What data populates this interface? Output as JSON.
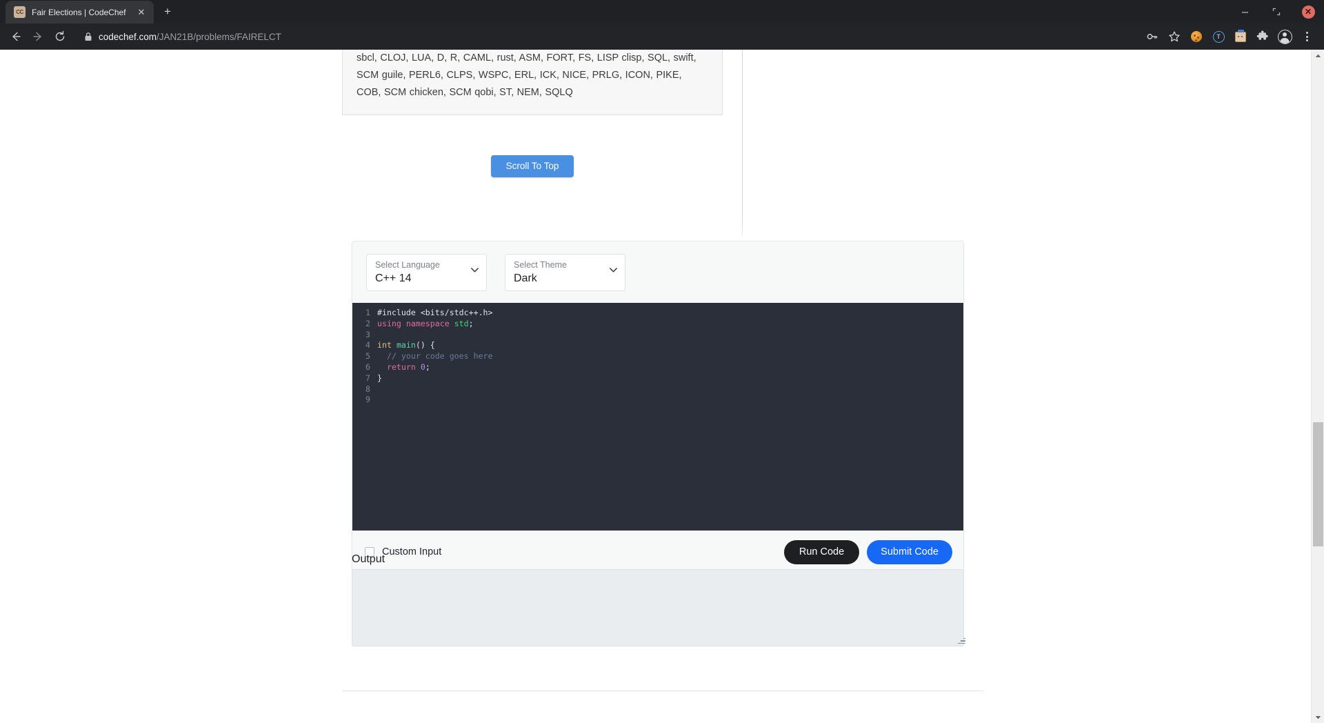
{
  "browser": {
    "tab": {
      "favicon_text": "CC",
      "favicon_name": "codechef-favicon",
      "title": "Fair Elections | CodeChef",
      "close_glyph": "✕"
    },
    "new_tab_glyph": "+",
    "window_controls": {
      "minimize_glyph": "─",
      "maximize_glyph": "⤡",
      "close_glyph": "✕"
    },
    "toolbar": {
      "url_domain": "codechef.com",
      "url_path": "/JAN21B/problems/FAIRELCT",
      "icons": [
        "back-icon",
        "forward-icon",
        "reload-icon",
        "lock-icon",
        "password-key-icon",
        "bookmark-star-icon",
        "cookie-icon",
        "translate-t-icon",
        "package-box-icon",
        "extensions-puzzle-icon",
        "profile-avatar-icon",
        "menu-kebab-icon"
      ],
      "translate_letter": "T"
    }
  },
  "page": {
    "languages_panel": {
      "text": "sbcl, CLOJ, LUA, D, R, CAML, rust, ASM, FORT, FS, LISP clisp, SQL, swift, SCM guile, PERL6, CLPS, WSPC, ERL, ICK, NICE, PRLG, ICON, PIKE, COB, SCM chicken, SCM qobi, ST, NEM, SQLQ"
    },
    "scroll_to_top_label": "Scroll To Top",
    "ide": {
      "language_select": {
        "label": "Select Language",
        "value": "C++ 14"
      },
      "theme_select": {
        "label": "Select Theme",
        "value": "Dark"
      },
      "editor": {
        "theme": "dark",
        "background": "#2a2f3a",
        "line_numbers": [
          "1",
          "2",
          "3",
          "4",
          "5",
          "6",
          "7",
          "8",
          "9"
        ],
        "lines": [
          {
            "n": "1",
            "tokens": [
              {
                "t": "#include <bits/stdc++.h>",
                "c": "plain"
              }
            ]
          },
          {
            "n": "2",
            "tokens": [
              {
                "t": "using",
                "c": "kw"
              },
              {
                "t": " ",
                "c": "plain"
              },
              {
                "t": "namespace",
                "c": "kw"
              },
              {
                "t": " ",
                "c": "plain"
              },
              {
                "t": "std",
                "c": "green"
              },
              {
                "t": ";",
                "c": "punc"
              }
            ]
          },
          {
            "n": "3",
            "tokens": []
          },
          {
            "n": "4",
            "tokens": [
              {
                "t": "int",
                "c": "type"
              },
              {
                "t": " ",
                "c": "plain"
              },
              {
                "t": "main",
                "c": "fn"
              },
              {
                "t": "() {",
                "c": "punc"
              }
            ]
          },
          {
            "n": "5",
            "tokens": [
              {
                "t": "  // your code goes here",
                "c": "comment"
              }
            ]
          },
          {
            "n": "6",
            "tokens": [
              {
                "t": "  ",
                "c": "plain"
              },
              {
                "t": "return",
                "c": "kw"
              },
              {
                "t": " ",
                "c": "plain"
              },
              {
                "t": "0",
                "c": "num"
              },
              {
                "t": ";",
                "c": "punc"
              }
            ]
          },
          {
            "n": "7",
            "tokens": [
              {
                "t": "}",
                "c": "punc"
              }
            ]
          },
          {
            "n": "8",
            "tokens": []
          },
          {
            "n": "9",
            "tokens": []
          }
        ]
      },
      "custom_input_label": "Custom Input",
      "custom_input_checked": false,
      "run_code_label": "Run Code",
      "submit_code_label": "Submit Code"
    },
    "output": {
      "label": "Output",
      "value": "",
      "placeholder": ""
    }
  },
  "colors": {
    "accent_blue": "#1668f5",
    "scroll_top_blue": "#4a90e2",
    "run_dark": "#1d1f22",
    "editor_bg": "#2a2f3a",
    "output_bg": "#e9edf0"
  }
}
